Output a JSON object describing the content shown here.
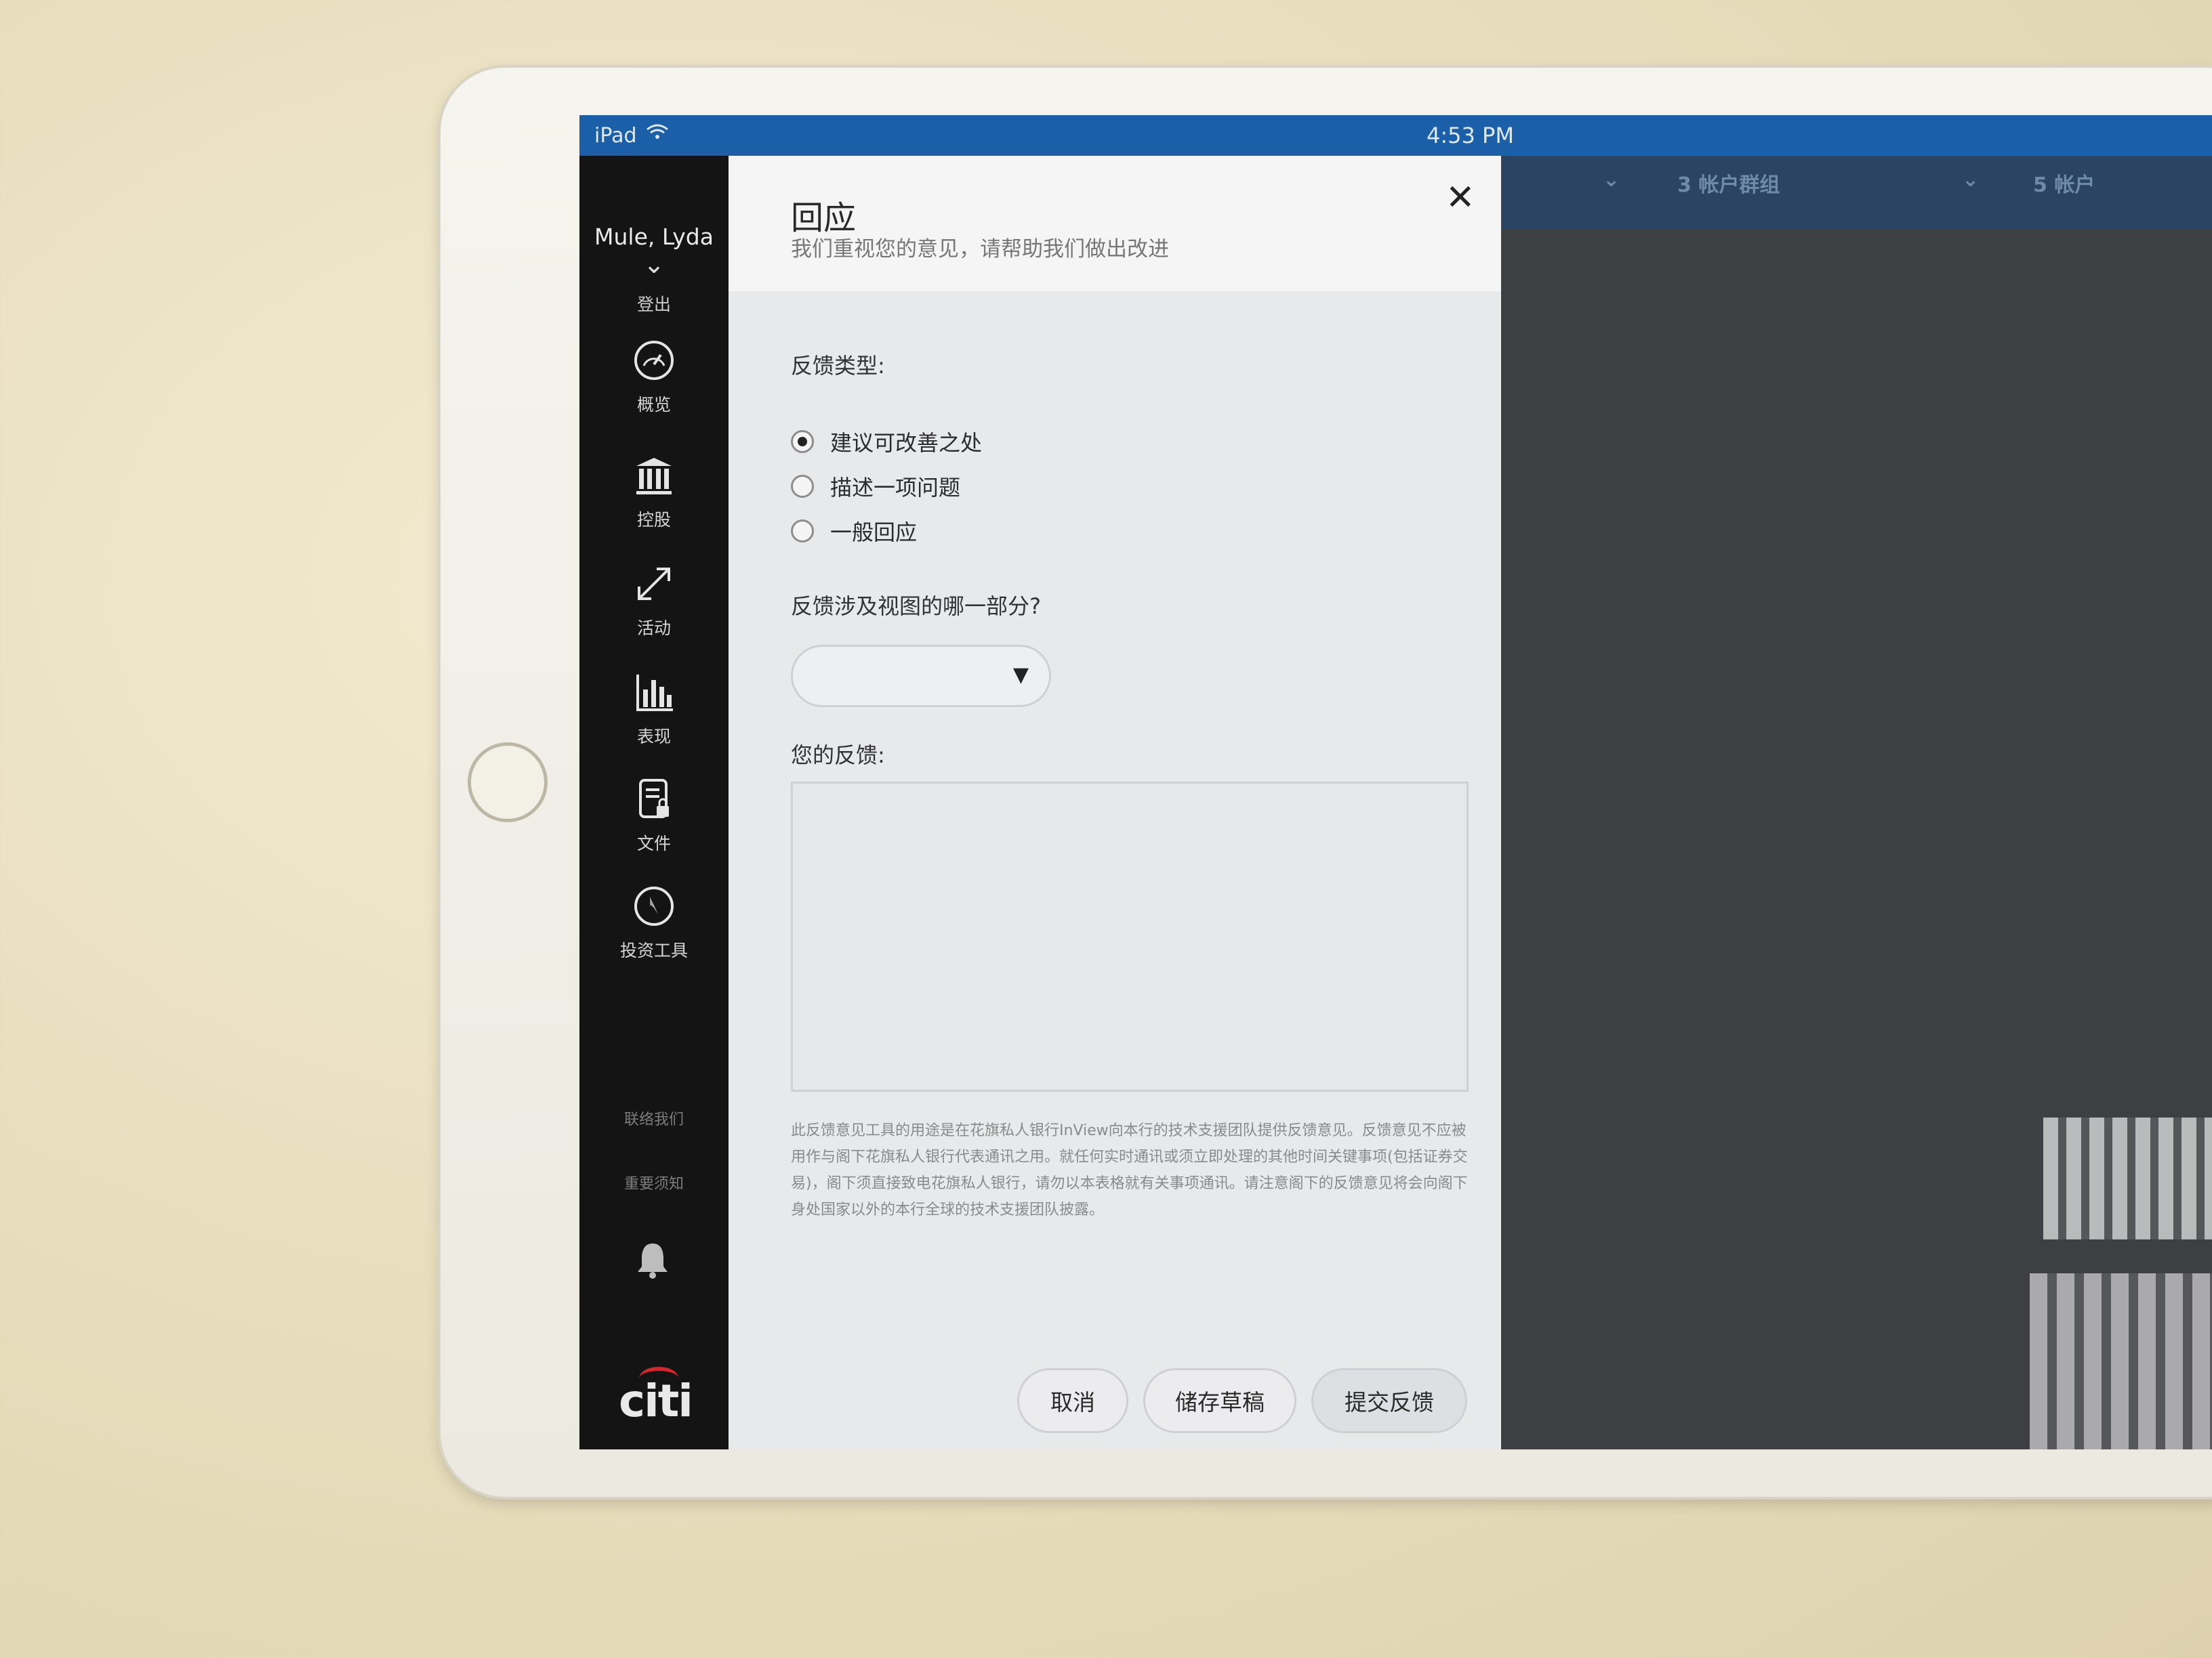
{
  "status_bar": {
    "carrier": "iPad",
    "time": "4:53 PM"
  },
  "sidebar": {
    "user_name": "Mule, Lyda",
    "logout_label": "登出",
    "nav": [
      {
        "label": "概览",
        "icon": "gauge-icon"
      },
      {
        "label": "控股",
        "icon": "bank-icon"
      },
      {
        "label": "活动",
        "icon": "transfer-arrows-icon"
      },
      {
        "label": "表现",
        "icon": "bar-chart-icon"
      },
      {
        "label": "文件",
        "icon": "locked-document-icon"
      },
      {
        "label": "投资工具",
        "icon": "compass-icon"
      }
    ],
    "contact_label": "联络我们",
    "notice_label": "重要须知",
    "logo_text": "citi"
  },
  "modal": {
    "title": "回应",
    "subtitle": "我们重视您的意见，请帮助我们做出改进",
    "feedback_type_label": "反馈类型:",
    "options": [
      {
        "label": "建议可改善之处",
        "selected": true
      },
      {
        "label": "描述一项问题",
        "selected": false
      },
      {
        "label": "一般回应",
        "selected": false
      }
    ],
    "section_label": "反馈涉及视图的哪一部分?",
    "section_value": "",
    "feedback_label": "您的反馈:",
    "feedback_value": "",
    "disclaimer": "此反馈意见工具的用途是在花旗私人银行InView向本行的技术支援团队提供反馈意见。反馈意见不应被用作与阁下花旗私人银行代表通讯之用。就任何实时通讯或须立即处理的其他时间关键事项(包括证券交易)，阁下须直接致电花旗私人银行，请勿以本表格就有关事项通讯。请注意阁下的反馈意见将会向阁下身处国家以外的本行全球的技术支援团队披露。",
    "buttons": {
      "cancel": "取消",
      "save_draft": "储存草稿",
      "submit": "提交反馈"
    }
  },
  "background": {
    "tab1": "3 帐户群组",
    "tab2": "5 帐户"
  },
  "colors": {
    "status_bar": "#1b5fa8",
    "sidebar": "#141414",
    "modal": "#e8e9eb",
    "brand_red": "#d7262b"
  }
}
